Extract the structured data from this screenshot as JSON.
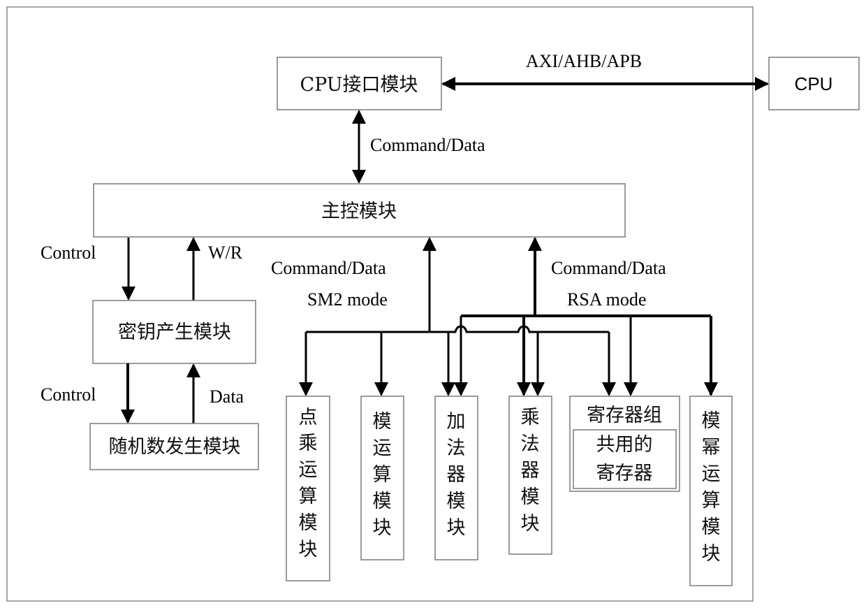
{
  "diagram": {
    "outer_frame": "chip",
    "modules": {
      "cpu_interface": "CPU接口模块",
      "cpu": "CPU",
      "main_control": "主控模块",
      "key_generation": "密钥产生模块",
      "random_number": "随机数发生模块",
      "point_multiplication": [
        "点",
        "乘",
        "运",
        "算",
        "模",
        "块"
      ],
      "modular_operation": [
        "模",
        "运",
        "算",
        "模",
        "块"
      ],
      "adder": [
        "加",
        "法",
        "器",
        "模",
        "块"
      ],
      "multiplier": [
        "乘",
        "法",
        "器",
        "模",
        "块"
      ],
      "register_group": {
        "title": "寄存器组",
        "shared_line1": "共用的",
        "shared_line2": "寄存器"
      },
      "modular_exponentiation": [
        "模",
        "幂",
        "运",
        "算",
        "模",
        "块"
      ]
    },
    "labels": {
      "bus": "AXI/AHB/APB",
      "cpu_to_main": "Command/Data",
      "control_1": "Control",
      "wr": "W/R",
      "control_2": "Control",
      "data": "Data",
      "sm2_cmd": "Command/Data",
      "sm2_mode": "SM2 mode",
      "rsa_cmd": "Command/Data",
      "rsa_mode": "RSA mode"
    }
  }
}
